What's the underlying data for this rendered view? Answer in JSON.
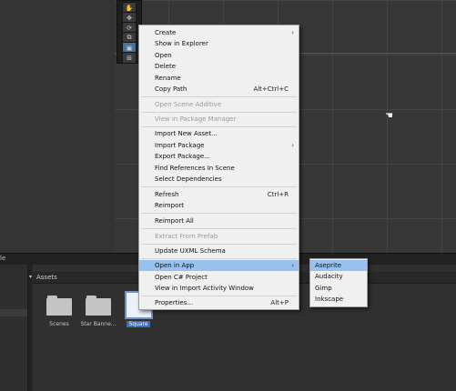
{
  "scene": {
    "toolbar_icons": [
      "hand-tool-icon",
      "move-tool-icon",
      "rotate-tool-icon",
      "scale-tool-icon",
      "rect-tool-icon",
      "transform-tool-icon"
    ],
    "cursor_glyph": "☚"
  },
  "bottom": {
    "left_tab_label": "le",
    "assets_title": "Assets",
    "assets_caret": "▾",
    "assets": [
      {
        "label": "Scenes",
        "icon": "folder-icon"
      },
      {
        "label": "Star Banne...",
        "icon": "folder-icon"
      },
      {
        "label": "Square",
        "icon": "sprite-square-icon",
        "selected": true
      }
    ]
  },
  "context_menu": {
    "items": [
      {
        "label": "Create",
        "arrow": "›"
      },
      {
        "label": "Show in Explorer"
      },
      {
        "label": "Open"
      },
      {
        "label": "Delete"
      },
      {
        "label": "Rename"
      },
      {
        "label": "Copy Path",
        "shortcut": "Alt+Ctrl+C"
      },
      {
        "label": "Open Scene Additive",
        "disabled": true
      },
      {
        "label": "View in Package Manager",
        "disabled": true
      },
      {
        "label": "Import New Asset..."
      },
      {
        "label": "Import Package",
        "arrow": "›"
      },
      {
        "label": "Export Package..."
      },
      {
        "label": "Find References In Scene"
      },
      {
        "label": "Select Dependencies"
      },
      {
        "label": "Refresh",
        "shortcut": "Ctrl+R"
      },
      {
        "label": "Reimport"
      },
      {
        "label": "Reimport All"
      },
      {
        "label": "Extract From Prefab",
        "disabled": true
      },
      {
        "label": "Update UXML Schema"
      },
      {
        "label": "Open in App",
        "arrow": "›",
        "highlighted": true
      },
      {
        "label": "Open C# Project"
      },
      {
        "label": "View in Import Activity Window"
      },
      {
        "label": "Properties...",
        "shortcut": "Alt+P"
      }
    ]
  },
  "submenu": {
    "items": [
      {
        "label": "Aseprite",
        "highlighted": true
      },
      {
        "label": "Audacity"
      },
      {
        "label": "Gimp"
      },
      {
        "label": "Inkscape"
      }
    ]
  }
}
